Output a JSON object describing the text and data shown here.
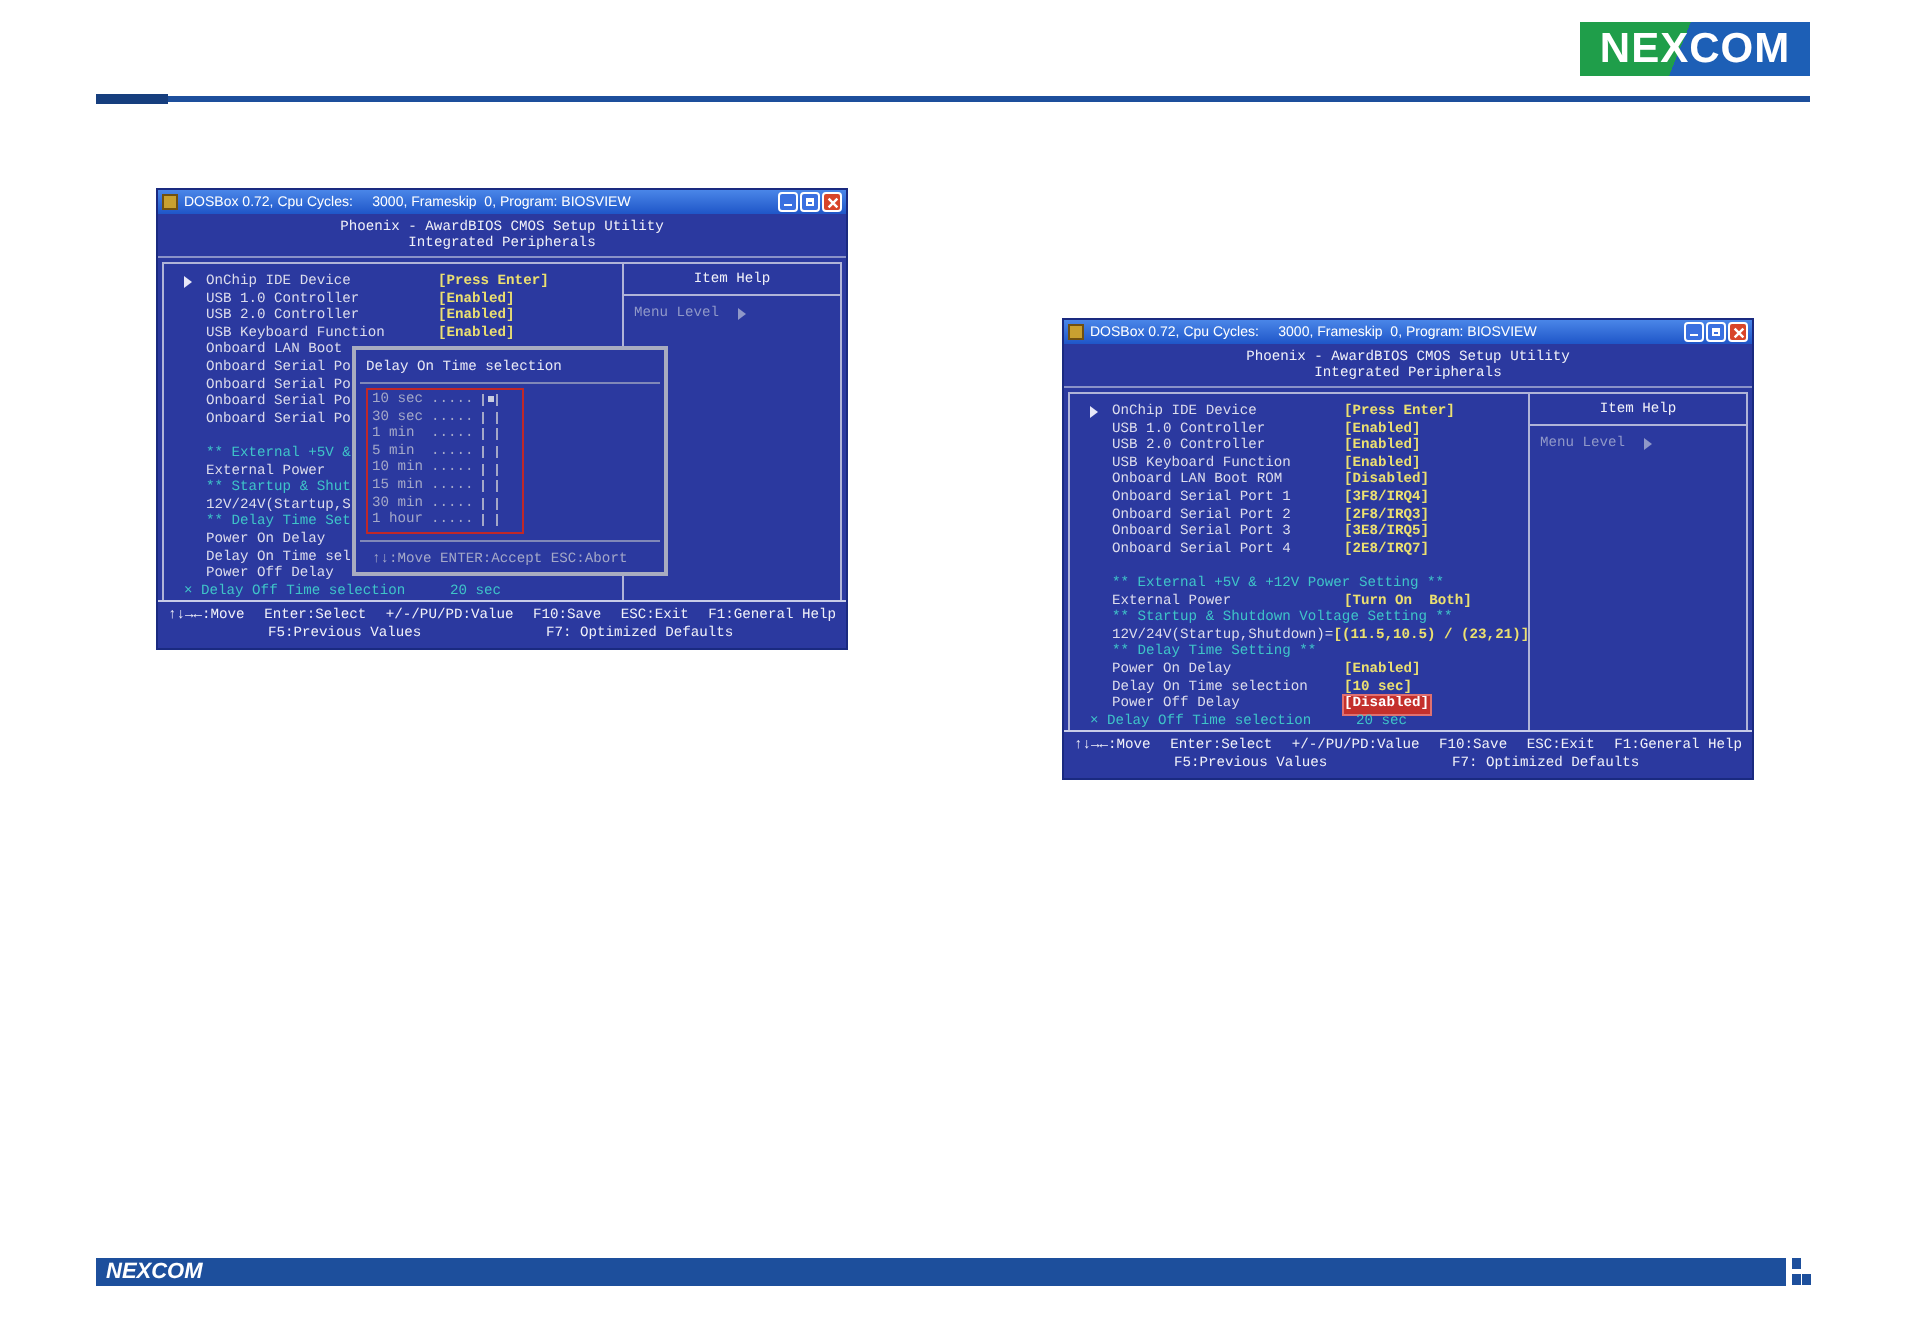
{
  "header": {
    "logo": "NEXCOM"
  },
  "screens": [
    {
      "title": "DOSBox 0.72, Cpu Cycles:     3000, Frameskip  0, Program: BIOSVIEW",
      "heading": [
        "Phoenix - AwardBIOS CMOS Setup Utility",
        "Integrated Peripherals"
      ],
      "rows": [
        {
          "kind": "submenu",
          "label": "OnChip IDE Device",
          "value": "[Press Enter]",
          "selected": false
        },
        {
          "kind": "item",
          "label": "USB 1.0 Controller",
          "value": "[Enabled]",
          "selected": false
        },
        {
          "kind": "item",
          "label": "USB 2.0 Controller",
          "value": "[Enabled]",
          "selected": false
        },
        {
          "kind": "item",
          "label": "USB Keyboard Function",
          "value": "[Enabled]",
          "selected": false
        },
        {
          "kind": "item",
          "label": "Onboard LAN Boot",
          "selected": false
        },
        {
          "kind": "item",
          "label": "Onboard Serial Po",
          "selected": false
        },
        {
          "kind": "item",
          "label": "Onboard Serial Po",
          "selected": false
        },
        {
          "kind": "item",
          "label": "Onboard Serial Po",
          "selected": false
        },
        {
          "kind": "item",
          "label": "Onboard Serial Po",
          "selected": false
        },
        {
          "kind": "spacer"
        },
        {
          "kind": "section",
          "label": "** External +5V &",
          "selected": false
        },
        {
          "kind": "item",
          "label": "External Power",
          "selected": false
        },
        {
          "kind": "section",
          "label": "** Startup & Shut",
          "selected": false
        },
        {
          "kind": "item",
          "label": "12V/24V(Startup,S",
          "selected": false
        },
        {
          "kind": "section",
          "label": "** Delay Time Set",
          "selected": false
        },
        {
          "kind": "item",
          "label": "Power On Delay",
          "selected": false
        },
        {
          "kind": "item",
          "label": "Delay On Time sel",
          "selected": false
        },
        {
          "kind": "item",
          "label": "Power Off Delay",
          "selected": false
        },
        {
          "kind": "disabled",
          "label": "× Delay Off Time selection",
          "value": "20 sec",
          "selected": false
        }
      ],
      "help": {
        "title": "Item Help",
        "menu_level": "Menu Level"
      },
      "keys": [
        [
          "↑↓→←:Move",
          "Enter:Select",
          "+/-/PU/PD:Value",
          "F10:Save",
          "ESC:Exit",
          "F1:General Help"
        ],
        [
          "F5:Previous Values",
          "F7: Optimized Defaults"
        ]
      ],
      "popup": {
        "title": "Delay On Time selection",
        "options": [
          {
            "label": "10 sec",
            "leader": ".....",
            "selected": true
          },
          {
            "label": "30 sec",
            "leader": ".....",
            "selected": false
          },
          {
            "label": "1 min",
            "leader": ".....",
            "selected": false
          },
          {
            "label": "5 min",
            "leader": ".....",
            "selected": false
          },
          {
            "label": "10 min",
            "leader": ".....",
            "selected": false
          },
          {
            "label": "15 min",
            "leader": ".....",
            "selected": false
          },
          {
            "label": "30 min",
            "leader": ".....",
            "selected": false
          },
          {
            "label": "1 hour",
            "leader": ".....",
            "selected": false
          }
        ],
        "hint": "↑↓:Move ENTER:Accept ESC:Abort"
      }
    },
    {
      "title": "DOSBox 0.72, Cpu Cycles:     3000, Frameskip  0, Program: BIOSVIEW",
      "heading": [
        "Phoenix - AwardBIOS CMOS Setup Utility",
        "Integrated Peripherals"
      ],
      "rows": [
        {
          "kind": "submenu",
          "label": "OnChip IDE Device",
          "value": "[Press Enter]",
          "selected": false
        },
        {
          "kind": "item",
          "label": "USB 1.0 Controller",
          "value": "[Enabled]",
          "selected": false
        },
        {
          "kind": "item",
          "label": "USB 2.0 Controller",
          "value": "[Enabled]",
          "selected": false
        },
        {
          "kind": "item",
          "label": "USB Keyboard Function",
          "value": "[Enabled]",
          "selected": false
        },
        {
          "kind": "item",
          "label": "Onboard LAN Boot ROM",
          "value": "[Disabled]",
          "selected": false
        },
        {
          "kind": "item",
          "label": "Onboard Serial Port 1",
          "value": "[3F8/IRQ4]",
          "selected": false
        },
        {
          "kind": "item",
          "label": "Onboard Serial Port 2",
          "value": "[2F8/IRQ3]",
          "selected": false
        },
        {
          "kind": "item",
          "label": "Onboard Serial Port 3",
          "value": "[3E8/IRQ5]",
          "selected": false
        },
        {
          "kind": "item",
          "label": "Onboard Serial Port 4",
          "value": "[2E8/IRQ7]",
          "selected": false
        },
        {
          "kind": "spacer"
        },
        {
          "kind": "section",
          "label": "** External +5V & +12V Power Setting **",
          "selected": false
        },
        {
          "kind": "item",
          "label": "External Power",
          "value": "[Turn On  Both]",
          "selected": false
        },
        {
          "kind": "section",
          "label": "** Startup & Shutdown Voltage Setting **",
          "selected": false
        },
        {
          "kind": "combined",
          "label": "12V/24V(Startup,Shutdown)=",
          "value": "[(11.5,10.5) / (23,21)]",
          "selected": false
        },
        {
          "kind": "section",
          "label": "** Delay Time Setting **",
          "selected": false
        },
        {
          "kind": "item",
          "label": "Power On Delay",
          "value": "[Enabled]",
          "selected": false
        },
        {
          "kind": "item",
          "label": "Delay On Time selection",
          "value": "[10 sec]",
          "selected": false
        },
        {
          "kind": "item",
          "label": "Power Off Delay",
          "value": "[Disabled]",
          "selected": true
        },
        {
          "kind": "disabled",
          "label": "× Delay Off Time selection",
          "value": "20 sec",
          "selected": false
        }
      ],
      "help": {
        "title": "Item Help",
        "menu_level": "Menu Level"
      },
      "keys": [
        [
          "↑↓→←:Move",
          "Enter:Select",
          "+/-/PU/PD:Value",
          "F10:Save",
          "ESC:Exit",
          "F1:General Help"
        ],
        [
          "F5:Previous Values",
          "F7: Optimized Defaults"
        ]
      ]
    }
  ],
  "footer": {
    "logo": "NEXCOM"
  }
}
